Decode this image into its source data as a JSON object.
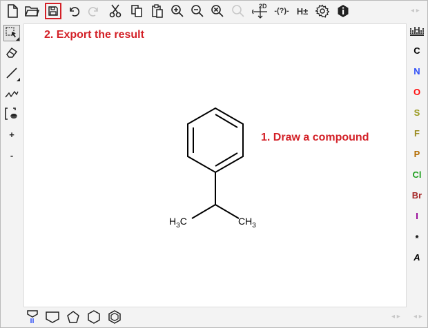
{
  "toolbar": {
    "dimension_label": "2D",
    "query_label": "-(?)-",
    "hydrogen_label": "H±"
  },
  "left_tools": {
    "charge_plus": "+",
    "charge_minus": "-"
  },
  "atoms": [
    {
      "symbol": "H",
      "color": "#333333"
    },
    {
      "symbol": "C",
      "color": "#000000"
    },
    {
      "symbol": "N",
      "color": "#304ff7"
    },
    {
      "symbol": "O",
      "color": "#ff0d0d"
    },
    {
      "symbol": "S",
      "color": "#9a9a1f"
    },
    {
      "symbol": "F",
      "color": "#9a8a1f"
    },
    {
      "symbol": "P",
      "color": "#b36b00"
    },
    {
      "symbol": "Cl",
      "color": "#1fa01f"
    },
    {
      "symbol": "Br",
      "color": "#a62929"
    },
    {
      "symbol": "I",
      "color": "#940094"
    },
    {
      "symbol": "*",
      "color": "#000000"
    },
    {
      "symbol": "A",
      "color": "#000000"
    }
  ],
  "canvas": {
    "annotation_export": "2. Export the result",
    "annotation_draw": "1. Draw a compound",
    "molecule": {
      "left_methyl": {
        "main": "H",
        "sub": "3",
        "tail": "C"
      },
      "right_methyl": {
        "main": "CH",
        "sub": "3"
      }
    }
  },
  "colors": {
    "annotation": "#d32027",
    "highlight": "#d32027"
  }
}
